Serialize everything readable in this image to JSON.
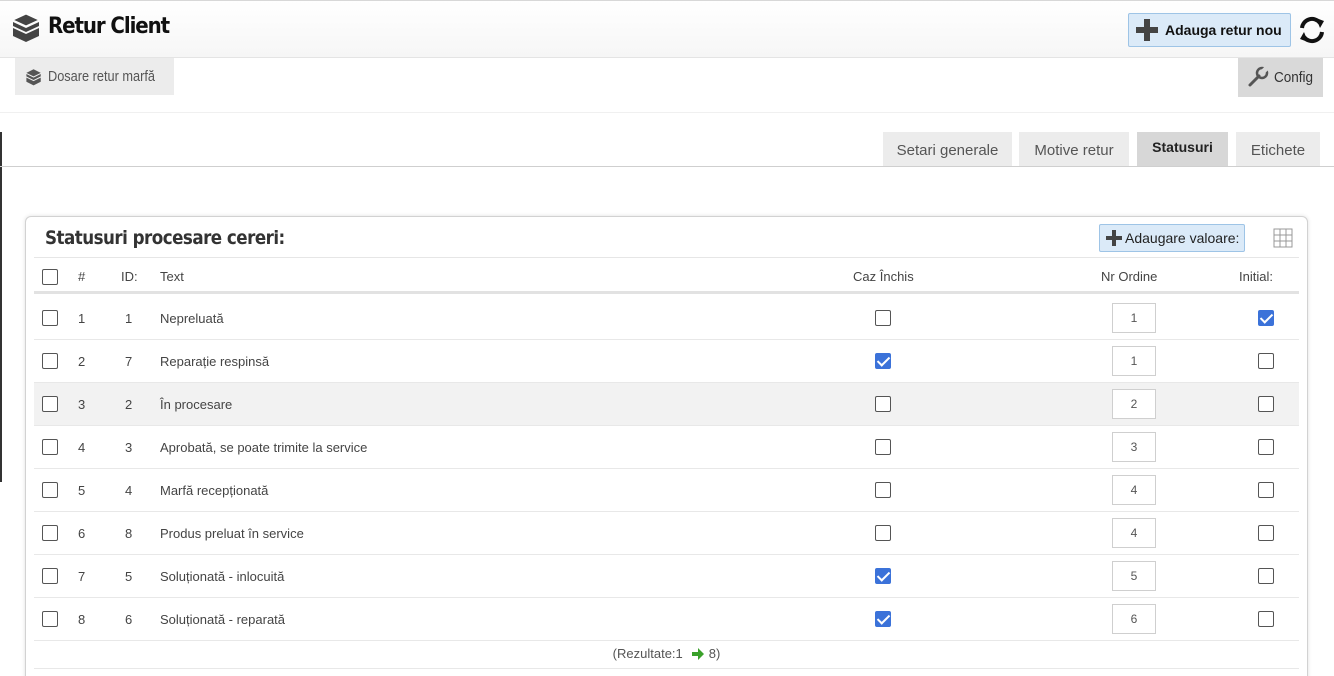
{
  "header": {
    "title": "Retur Client",
    "add_button_label": "Adauga retur nou"
  },
  "subnav": {
    "dosare_label": "Dosare retur marfă",
    "config_label": "Config"
  },
  "tabs": [
    {
      "label": "Setari generale",
      "active": false
    },
    {
      "label": "Motive retur",
      "active": false
    },
    {
      "label": "Statusuri",
      "active": true
    },
    {
      "label": "Etichete",
      "active": false
    }
  ],
  "panel": {
    "title": "Statusuri procesare cereri:",
    "add_value_label": "Adaugare valoare:"
  },
  "table": {
    "columns": {
      "index": "#",
      "id": "ID:",
      "text": "Text",
      "closed": "Caz Închis",
      "order": "Nr Ordine",
      "initial": "Initial:"
    },
    "rows": [
      {
        "index": "1",
        "id": "1",
        "text": "Nepreluată",
        "closed": false,
        "order": "1",
        "initial": true
      },
      {
        "index": "2",
        "id": "7",
        "text": "Reparație respinsă",
        "closed": true,
        "order": "1",
        "initial": false
      },
      {
        "index": "3",
        "id": "2",
        "text": "În procesare",
        "closed": false,
        "order": "2",
        "initial": false
      },
      {
        "index": "4",
        "id": "3",
        "text": "Aprobată, se poate trimite la service",
        "closed": false,
        "order": "3",
        "initial": false
      },
      {
        "index": "5",
        "id": "4",
        "text": "Marfă recepționată",
        "closed": false,
        "order": "4",
        "initial": false
      },
      {
        "index": "6",
        "id": "8",
        "text": "Produs preluat în service",
        "closed": false,
        "order": "4",
        "initial": false
      },
      {
        "index": "7",
        "id": "5",
        "text": "Soluționată - inlocuită",
        "closed": true,
        "order": "5",
        "initial": false
      },
      {
        "index": "8",
        "id": "6",
        "text": "Soluționată - reparată",
        "closed": true,
        "order": "6",
        "initial": false
      }
    ]
  },
  "footer": {
    "results_prefix": "(Rezultate:1",
    "results_suffix": "8)"
  },
  "colors": {
    "accent_button_bg": "#dbeaf8",
    "checkbox_checked": "#3b72d9",
    "arrow_green": "#3aa12a"
  }
}
